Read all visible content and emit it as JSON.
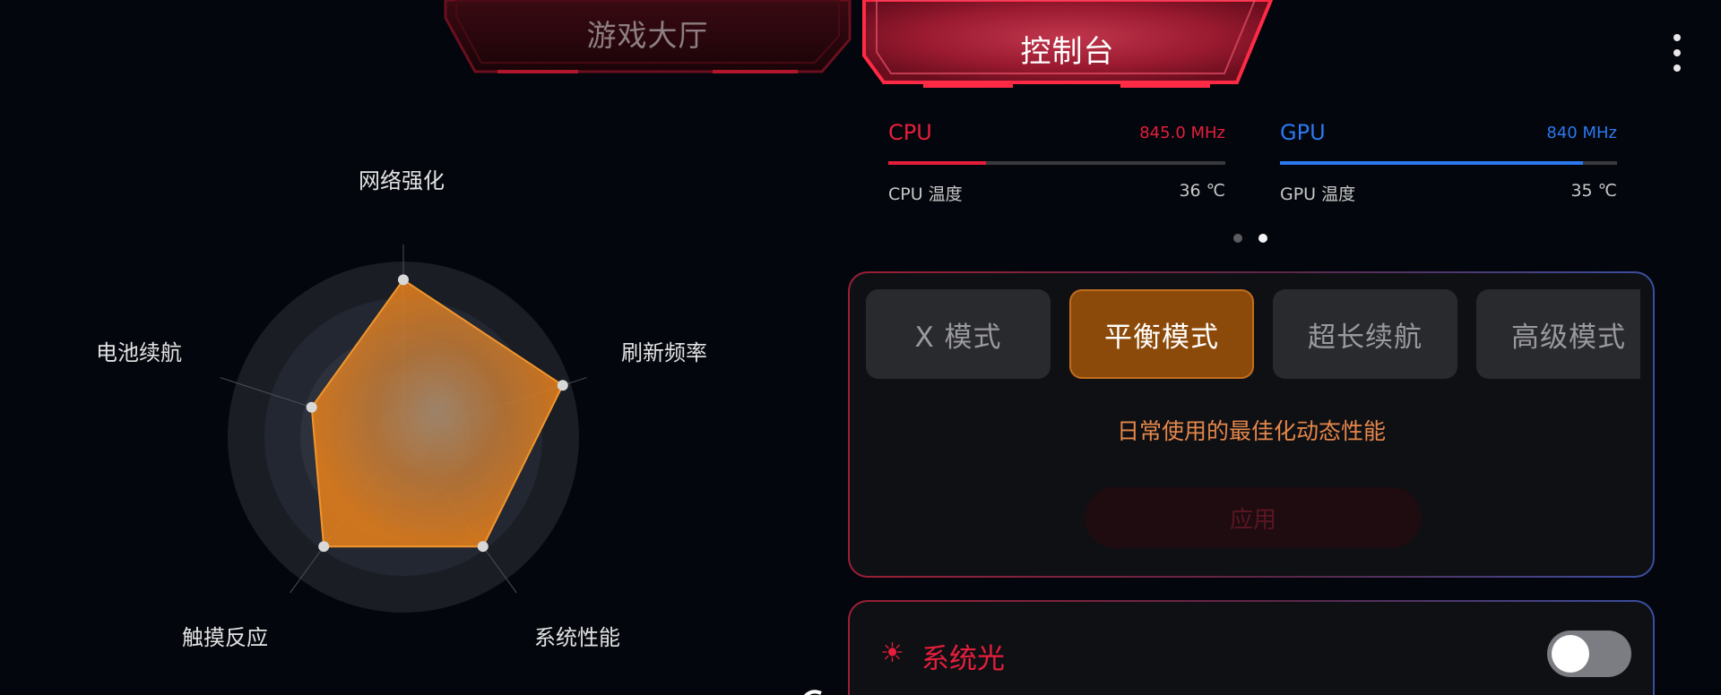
{
  "tabs": {
    "lobby": "游戏大厅",
    "console": "控制台"
  },
  "radar": {
    "labels": {
      "network": "网络强化",
      "refresh": "刷新频率",
      "performance": "系统性能",
      "touch": "触摸反应",
      "battery": "电池续航"
    },
    "values": {
      "network": 0.93,
      "refresh": 0.99,
      "performance": 0.8,
      "touch": 0.8,
      "battery": 0.57
    },
    "colors": {
      "fill": "#e07d1c",
      "stroke": "#f0962e"
    }
  },
  "stats": {
    "cpu": {
      "name": "CPU",
      "freq": "845.0 MHz",
      "temp_label": "CPU 温度",
      "temp_value": "36 ℃",
      "load": 0.29,
      "color": "#e61e3c"
    },
    "gpu": {
      "name": "GPU",
      "freq": "840 MHz",
      "temp_label": "GPU 温度",
      "temp_value": "35 ℃",
      "load": 0.9,
      "color": "#2c78f0"
    }
  },
  "modes": {
    "items": [
      "X 模式",
      "平衡模式",
      "超长续航",
      "高级模式"
    ],
    "selected": "平衡模式",
    "description": "日常使用的最佳化动态性能",
    "apply_label": "应用"
  },
  "system_light": {
    "title": "系统光",
    "icon": "sun-icon",
    "enabled": false
  },
  "icons": {
    "menu": "more-vertical-icon"
  }
}
